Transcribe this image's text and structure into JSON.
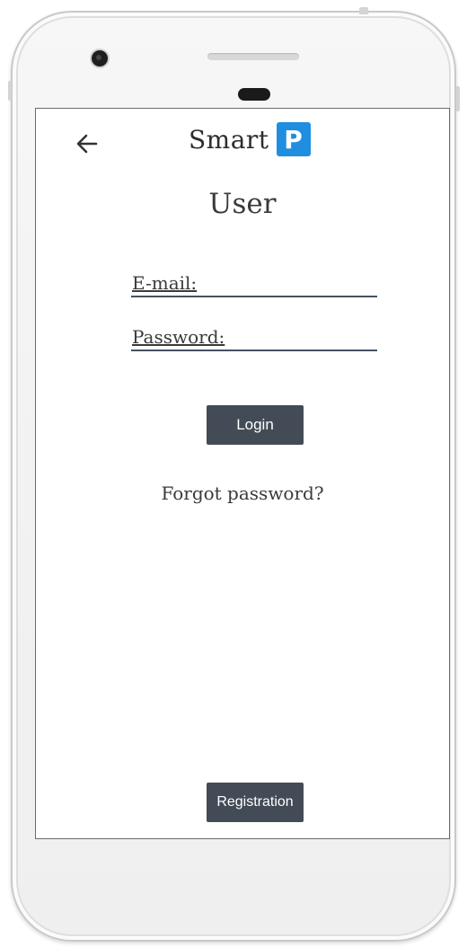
{
  "header": {
    "back_icon": "arrow-left-icon",
    "brand_text": "Smart",
    "brand_logo_letter": "P",
    "brand_logo_color": "#1f8ee0"
  },
  "page": {
    "title": "User"
  },
  "form": {
    "email_label": "E-mail:",
    "email_value": "",
    "password_label": "Password:",
    "password_value": ""
  },
  "buttons": {
    "login_label": "Login",
    "registration_label": "Registration",
    "button_color": "#434b56"
  },
  "links": {
    "forgot_password": "Forgot password?"
  },
  "device": {
    "frame_color": "#f3f3f3",
    "camera_icon": "front-camera-icon",
    "earpiece_icon": "earpiece-icon"
  }
}
